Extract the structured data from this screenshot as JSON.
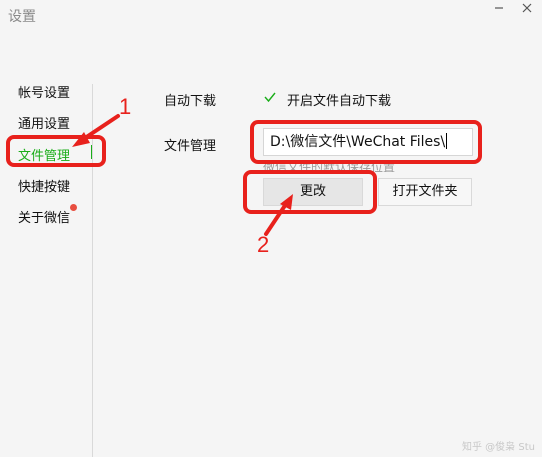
{
  "window": {
    "title": "设置",
    "minimize_icon": "minimize-icon",
    "close_icon": "close-icon"
  },
  "sidebar": {
    "items": [
      {
        "label": "帐号设置"
      },
      {
        "label": "通用设置"
      },
      {
        "label": "文件管理",
        "active": true
      },
      {
        "label": "快捷按键"
      },
      {
        "label": "关于微信",
        "badge": true
      }
    ]
  },
  "settings": {
    "auto_download_label": "自动下载",
    "auto_download_checkbox_label": "开启文件自动下载",
    "auto_download_checked": true,
    "file_manage_label": "文件管理",
    "path_value": "D:\\微信文件\\WeChat Files\\",
    "hint": "微信文件的默认保存位置",
    "change_button": "更改",
    "open_folder_button": "打开文件夹"
  },
  "annotations": {
    "marker_1": "1",
    "marker_2": "2"
  },
  "colors": {
    "accent_green": "#1aad19",
    "annotation_red": "#e8211c",
    "badge_red": "#e84e40"
  },
  "watermark": "知乎 @俊枭 Stu"
}
